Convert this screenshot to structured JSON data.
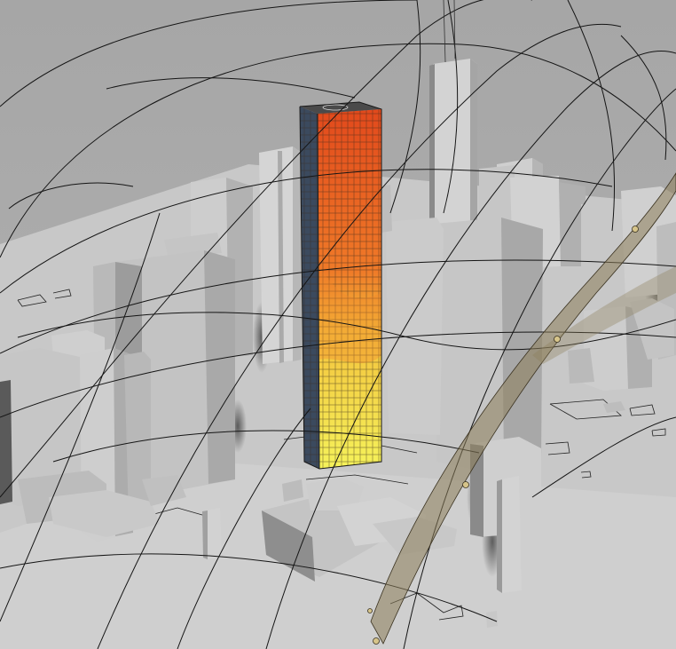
{
  "scene": {
    "type": "3d-viewport-render",
    "subject": "sun-path-diagram-over-city-massing",
    "colors": {
      "background": "#a9a9a9",
      "ground": "#c9c9c9",
      "building_light": "#d0d0d0",
      "building_mid": "#bdbdbd",
      "building_dark": "#8f8f8f",
      "sun_path_band": "#8c7d5a",
      "sun_marker": "#d6c48a",
      "analysis_high": "#e2491c",
      "analysis_mid": "#f29a2a",
      "analysis_low": "#f4ec4e"
    }
  }
}
